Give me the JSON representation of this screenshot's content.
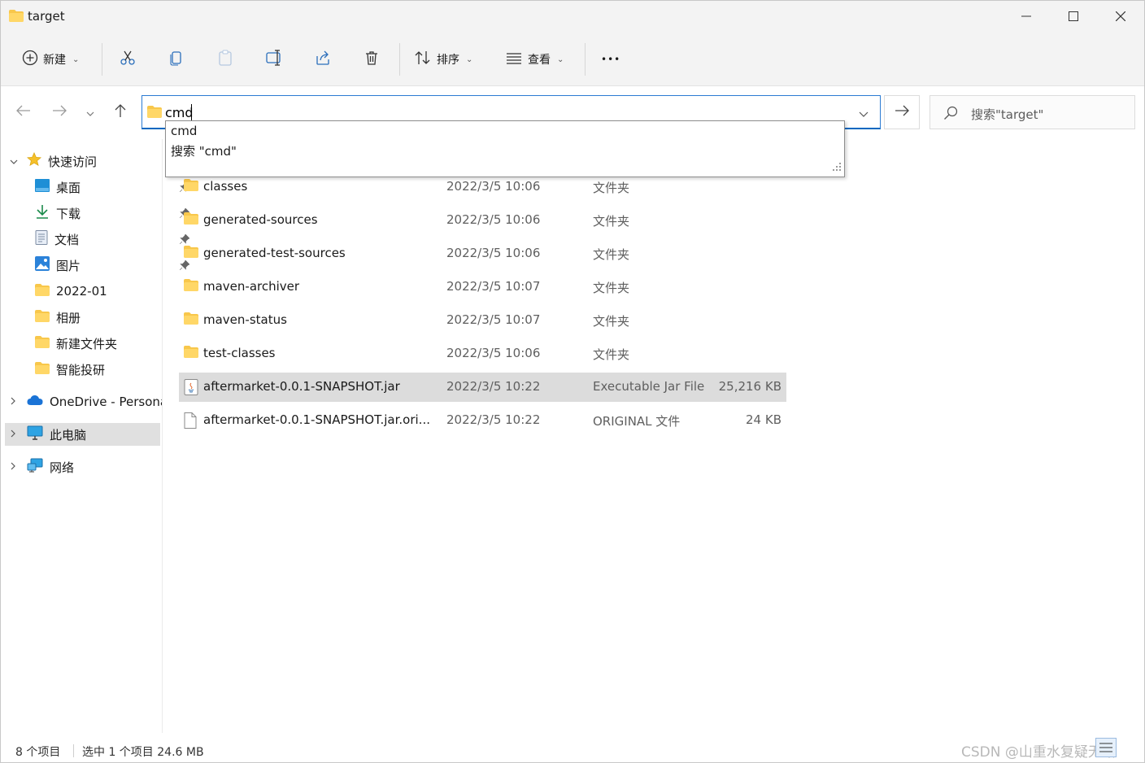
{
  "window": {
    "title": "target"
  },
  "toolbar": {
    "new_label": "新建",
    "sort_label": "排序",
    "view_label": "查看",
    "more_label": "•••"
  },
  "address": {
    "value": "cmd"
  },
  "search": {
    "placeholder": "搜索\"target\""
  },
  "suggestions": [
    "cmd",
    "搜索 \"cmd\""
  ],
  "nav": {
    "quick_access": "快速访问",
    "pinned": [
      {
        "label": "桌面",
        "icon": "desktop-icon"
      },
      {
        "label": "下载",
        "icon": "download-icon"
      },
      {
        "label": "文档",
        "icon": "document-icon"
      },
      {
        "label": "图片",
        "icon": "pictures-icon"
      }
    ],
    "folders": [
      "2022-01",
      "相册",
      "新建文件夹",
      "智能投研"
    ],
    "onedrive": "OneDrive - Persona",
    "this_pc": "此电脑",
    "network": "网络"
  },
  "files": [
    {
      "name": "classes",
      "date": "2022/3/5 10:06",
      "type": "文件夹",
      "size": "",
      "icon": "folder-icon"
    },
    {
      "name": "generated-sources",
      "date": "2022/3/5 10:06",
      "type": "文件夹",
      "size": "",
      "icon": "folder-icon"
    },
    {
      "name": "generated-test-sources",
      "date": "2022/3/5 10:06",
      "type": "文件夹",
      "size": "",
      "icon": "folder-icon"
    },
    {
      "name": "maven-archiver",
      "date": "2022/3/5 10:07",
      "type": "文件夹",
      "size": "",
      "icon": "folder-icon"
    },
    {
      "name": "maven-status",
      "date": "2022/3/5 10:07",
      "type": "文件夹",
      "size": "",
      "icon": "folder-icon"
    },
    {
      "name": "test-classes",
      "date": "2022/3/5 10:06",
      "type": "文件夹",
      "size": "",
      "icon": "folder-icon"
    },
    {
      "name": "aftermarket-0.0.1-SNAPSHOT.jar",
      "date": "2022/3/5 10:22",
      "type": "Executable Jar File",
      "size": "25,216 KB",
      "icon": "jar-icon",
      "selected": true
    },
    {
      "name": "aftermarket-0.0.1-SNAPSHOT.jar.ori...",
      "date": "2022/3/5 10:22",
      "type": "ORIGINAL 文件",
      "size": "24 KB",
      "icon": "file-icon"
    }
  ],
  "status": {
    "count": "8 个项目",
    "selection": "选中 1 个项目  24.6 MB"
  },
  "watermark": "CSDN @山重水复疑无路",
  "colors": {
    "accent": "#0067c0",
    "folder": "#f8c74b",
    "selection": "#dcdcdc"
  }
}
